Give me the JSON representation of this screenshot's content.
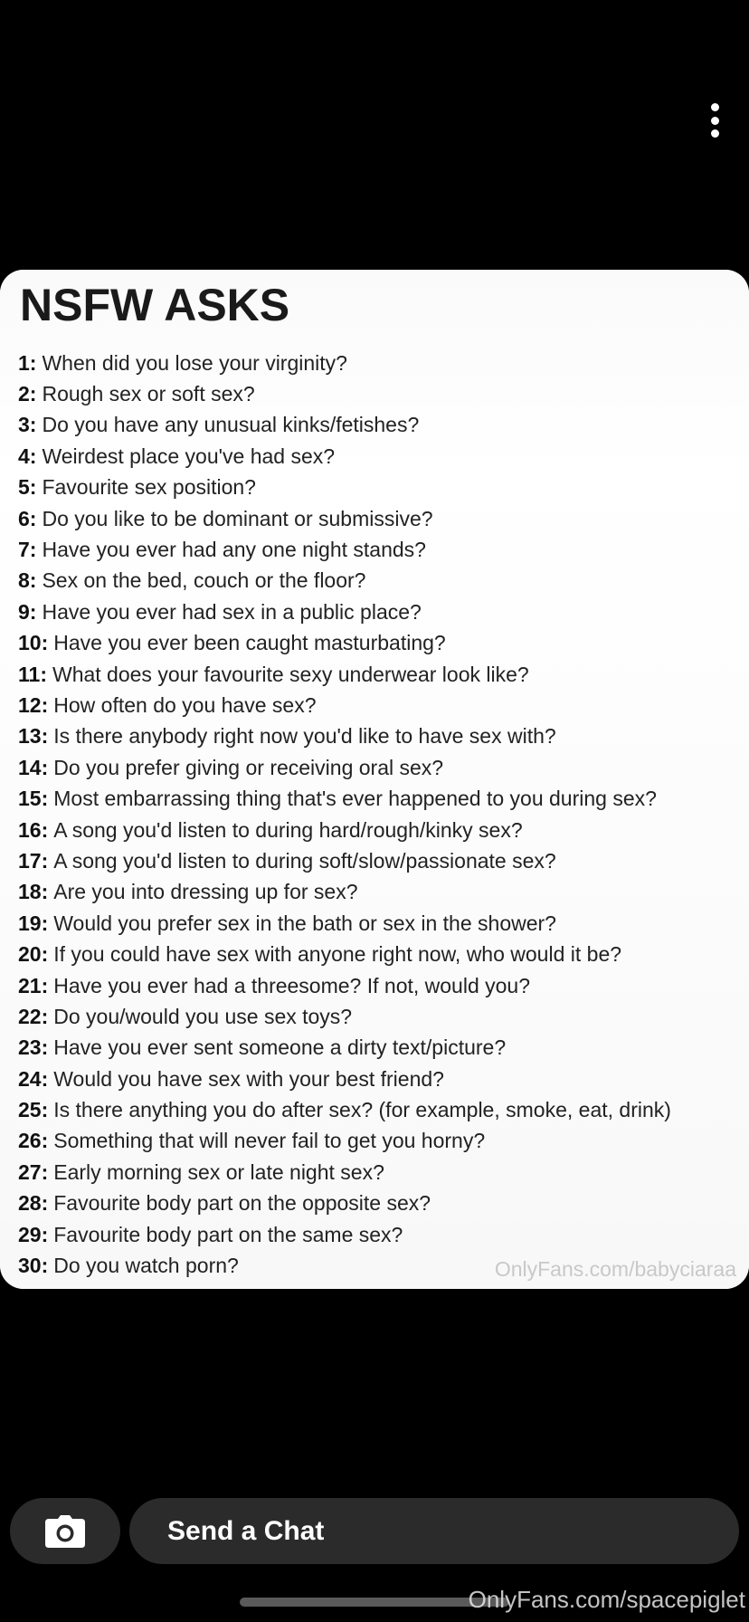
{
  "header": {
    "more_icon": "more-vertical-icon"
  },
  "card": {
    "title": "NSFW ASKS",
    "items": [
      {
        "num": "1:",
        "text": "When did you lose your virginity?"
      },
      {
        "num": "2:",
        "text": "Rough sex or soft sex?"
      },
      {
        "num": "3:",
        "text": "Do you have any unusual kinks/fetishes?"
      },
      {
        "num": "4:",
        "text": "Weirdest place you've had sex?"
      },
      {
        "num": "5:",
        "text": "Favourite sex position?"
      },
      {
        "num": "6:",
        "text": "Do you like to be dominant or submissive?"
      },
      {
        "num": "7:",
        "text": "Have you ever had any one night stands?"
      },
      {
        "num": "8:",
        "text": "Sex on the bed, couch or the floor?"
      },
      {
        "num": "9:",
        "text": "Have you ever had sex in a public place?"
      },
      {
        "num": "10:",
        "text": "Have you ever been caught masturbating?"
      },
      {
        "num": "11:",
        "text": "What does your favourite sexy underwear look like?"
      },
      {
        "num": "12:",
        "text": "How often do you have sex?"
      },
      {
        "num": "13:",
        "text": "Is there anybody right now you'd like to have sex with?"
      },
      {
        "num": "14:",
        "text": "Do you prefer giving or receiving oral sex?"
      },
      {
        "num": "15:",
        "text": "Most embarrassing thing that's ever happened to you during sex?"
      },
      {
        "num": "16:",
        "text": "A song you'd listen to during hard/rough/kinky sex?"
      },
      {
        "num": "17:",
        "text": "A song you'd listen to during soft/slow/passionate sex?"
      },
      {
        "num": "18:",
        "text": "Are you into dressing up for sex?"
      },
      {
        "num": "19:",
        "text": "Would you prefer sex in the bath or sex in the shower?"
      },
      {
        "num": "20:",
        "text": "If you could have sex with anyone right now, who would it be?"
      },
      {
        "num": "21:",
        "text": "Have you ever had a threesome? If not, would you?"
      },
      {
        "num": "22:",
        "text": "Do you/would you use sex toys?"
      },
      {
        "num": "23:",
        "text": "Have you ever sent someone a dirty text/picture?"
      },
      {
        "num": "24:",
        "text": "Would you have sex with your best friend?"
      },
      {
        "num": "25:",
        "text": "Is there anything you do after sex? (for example, smoke, eat, drink)"
      },
      {
        "num": "26:",
        "text": "Something that will never fail to get you horny?"
      },
      {
        "num": "27:",
        "text": "Early morning sex or late night sex?"
      },
      {
        "num": "28:",
        "text": "Favourite body part on the opposite sex?"
      },
      {
        "num": "29:",
        "text": "Favourite body part on the same sex?"
      },
      {
        "num": "30:",
        "text": "Do you watch porn?"
      }
    ],
    "watermark": "OnlyFans.com/babyciaraa"
  },
  "chat_bar": {
    "camera_icon": "camera-icon",
    "placeholder": "Send a Chat"
  },
  "overlay": {
    "watermark": "OnlyFans.com/spacepiglet"
  },
  "colors": {
    "background": "#000000",
    "input_bg": "#2b2b2b",
    "text_white": "#ffffff"
  }
}
